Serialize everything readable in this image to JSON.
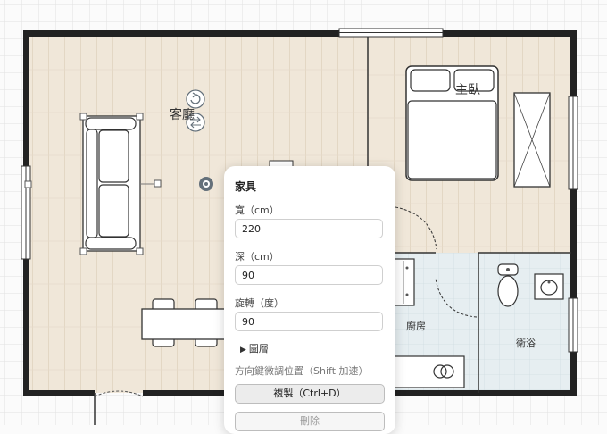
{
  "rooms": {
    "living": "客廳",
    "master_bedroom": "主臥",
    "kitchen": "廚房",
    "bathroom": "衛浴"
  },
  "panel": {
    "title": "家具",
    "width_label": "寬（cm）",
    "width_value": "220",
    "depth_label": "深（cm）",
    "depth_value": "90",
    "rotation_label": "旋轉（度）",
    "rotation_value": "90",
    "layers_label": "圖層",
    "hint": "方向鍵微調位置（Shift 加速）",
    "duplicate_label": "複製（Ctrl+D）",
    "delete_label": "刪除"
  },
  "icons": {
    "rotate": "rotate-icon",
    "swap": "swap-icon",
    "target": "target-icon",
    "expand": "triangle-right-icon"
  },
  "colors": {
    "floor": "#f0e7d9",
    "tile": "#e6eef1",
    "wall": "#222222",
    "handle": "#64707a"
  }
}
